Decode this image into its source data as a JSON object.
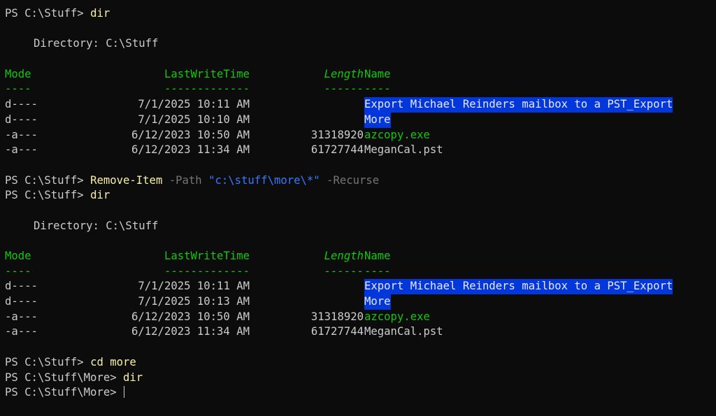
{
  "session": {
    "block1": {
      "prompt": "PS C:\\Stuff> ",
      "command": "dir",
      "directory_label": "Directory: C:\\Stuff"
    },
    "listing_headers": {
      "mode": "Mode",
      "lastwritetime": "LastWriteTime",
      "length": "Length",
      "name": "Name",
      "mode_ul": "----",
      "lastwritetime_ul": "-------------",
      "length_ul": "------",
      "name_ul": "----"
    },
    "listing1": [
      {
        "mode": "d----",
        "time": "7/1/2025 10:11 AM",
        "length": "",
        "name": "Export Michael Reinders mailbox to a PST_Export"
      },
      {
        "mode": "d----",
        "time": "7/1/2025 10:10 AM",
        "length": "",
        "name": "More"
      },
      {
        "mode": "-a---",
        "time": "6/12/2023 10:50 AM",
        "length": "31318920",
        "name": "azcopy.exe"
      },
      {
        "mode": "-a---",
        "time": "6/12/2023 11:34 AM",
        "length": "61727744",
        "name": "MeganCal.pst"
      }
    ],
    "block2": {
      "prompt": "PS C:\\Stuff> ",
      "cmdlet": "Remove-Item",
      "param_path": "-Path",
      "path_value": "\"c:\\stuff\\more\\*\"",
      "param_recurse": "-Recurse"
    },
    "block3": {
      "prompt": "PS C:\\Stuff> ",
      "command": "dir",
      "directory_label": "Directory: C:\\Stuff"
    },
    "listing2": [
      {
        "mode": "d----",
        "time": "7/1/2025 10:11 AM",
        "length": "",
        "name": "Export Michael Reinders mailbox to a PST_Export"
      },
      {
        "mode": "d----",
        "time": "7/1/2025 10:13 AM",
        "length": "",
        "name": "More"
      },
      {
        "mode": "-a---",
        "time": "6/12/2023 10:50 AM",
        "length": "31318920",
        "name": "azcopy.exe"
      },
      {
        "mode": "-a---",
        "time": "6/12/2023 11:34 AM",
        "length": "61727744",
        "name": "MeganCal.pst"
      }
    ],
    "block4": {
      "prompt": "PS C:\\Stuff> ",
      "command": "cd more"
    },
    "block5": {
      "prompt": "PS C:\\Stuff\\More> ",
      "command": "dir"
    },
    "block6": {
      "prompt": "PS C:\\Stuff\\More> "
    }
  },
  "colors": {
    "background": "#0c0c0c",
    "foreground": "#cccccc",
    "command": "#f9f1a5",
    "header_green": "#16c60c",
    "string_blue": "#3b78ff",
    "parameter_gray": "#767676",
    "directory_highlight": "#0037da"
  }
}
